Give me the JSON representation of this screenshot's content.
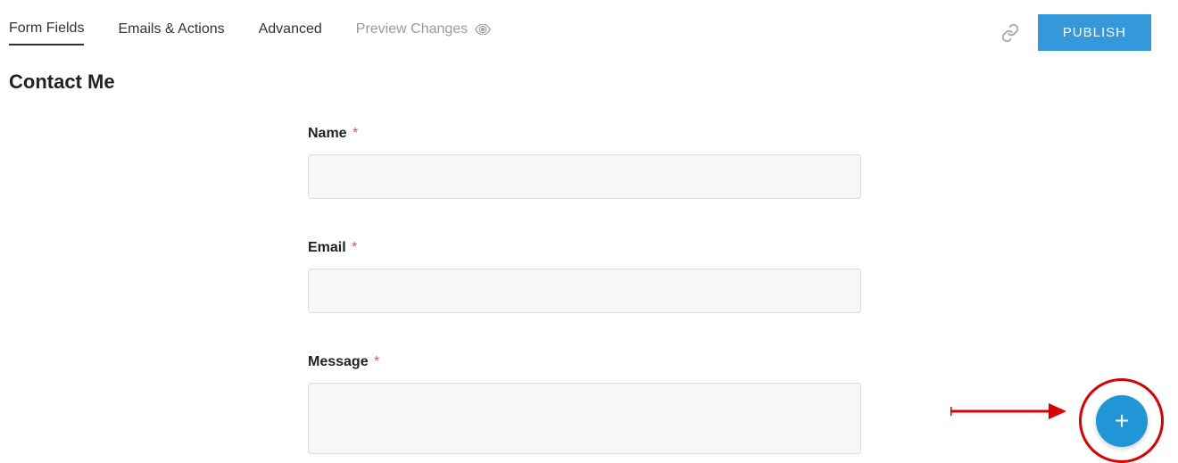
{
  "tabs": {
    "form_fields": "Form Fields",
    "emails_actions": "Emails & Actions",
    "advanced": "Advanced",
    "preview_changes": "Preview Changes"
  },
  "actions": {
    "publish": "PUBLISH"
  },
  "form": {
    "title": "Contact Me",
    "fields": {
      "name": {
        "label": "Name",
        "required": "*"
      },
      "email": {
        "label": "Email",
        "required": "*"
      },
      "message": {
        "label": "Message",
        "required": "*"
      }
    }
  },
  "fab": {
    "plus": "+"
  }
}
